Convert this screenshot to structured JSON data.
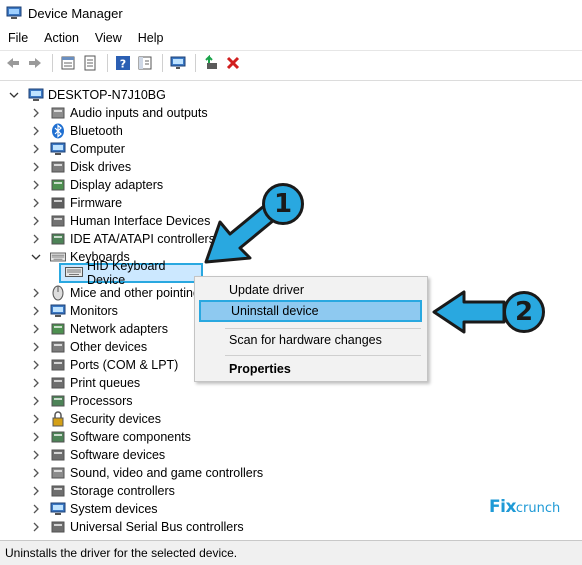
{
  "window": {
    "title": "Device Manager",
    "title_icon": "device-manager-icon"
  },
  "menu": [
    "File",
    "Action",
    "View",
    "Help"
  ],
  "toolbar": {
    "buttons": [
      "back-arrow-icon",
      "forward-arrow-icon",
      "properties-icon",
      "show-hidden-icon",
      "help-icon",
      "console-tree-icon",
      "monitor-scan-icon",
      "update-driver-icon",
      "uninstall-x-icon"
    ]
  },
  "tree": {
    "root": "DESKTOP-N7J10BG",
    "categories": [
      {
        "label": "Audio inputs and outputs",
        "icon": "speaker-icon"
      },
      {
        "label": "Bluetooth",
        "icon": "bluetooth-icon"
      },
      {
        "label": "Computer",
        "icon": "computer-icon"
      },
      {
        "label": "Disk drives",
        "icon": "disk-drive-icon"
      },
      {
        "label": "Display adapters",
        "icon": "display-adapter-icon"
      },
      {
        "label": "Firmware",
        "icon": "firmware-icon"
      },
      {
        "label": "Human Interface Devices",
        "icon": "hid-icon"
      },
      {
        "label": "IDE ATA/ATAPI controllers",
        "icon": "ide-controller-icon"
      },
      {
        "label": "Keyboards",
        "icon": "keyboard-icon",
        "expanded": true
      },
      {
        "label": "Mice and other pointing",
        "icon": "mouse-icon"
      },
      {
        "label": "Monitors",
        "icon": "monitor-icon"
      },
      {
        "label": "Network adapters",
        "icon": "network-adapter-icon"
      },
      {
        "label": "Other devices",
        "icon": "other-device-icon"
      },
      {
        "label": "Ports (COM & LPT)",
        "icon": "port-icon"
      },
      {
        "label": "Print queues",
        "icon": "printer-icon"
      },
      {
        "label": "Processors",
        "icon": "processor-icon"
      },
      {
        "label": "Security devices",
        "icon": "security-device-icon"
      },
      {
        "label": "Software components",
        "icon": "software-component-icon"
      },
      {
        "label": "Software devices",
        "icon": "software-device-icon"
      },
      {
        "label": "Sound, video and game controllers",
        "icon": "sound-icon"
      },
      {
        "label": "Storage controllers",
        "icon": "storage-controller-icon"
      },
      {
        "label": "System devices",
        "icon": "system-device-icon"
      },
      {
        "label": "Universal Serial Bus controllers",
        "icon": "usb-icon"
      }
    ],
    "selected_device": "HID Keyboard Device"
  },
  "context_menu": {
    "items": [
      "Update driver",
      "Uninstall device",
      "Scan for hardware changes",
      "Properties"
    ],
    "highlighted": "Uninstall device"
  },
  "status_bar": "Uninstalls the driver for the selected device.",
  "annotations": [
    "1",
    "2"
  ],
  "colors": {
    "highlight": "#29a8e0",
    "annotation": "#29a8e0"
  },
  "watermark": {
    "prefix": "Fix",
    "rest": "crunch"
  }
}
